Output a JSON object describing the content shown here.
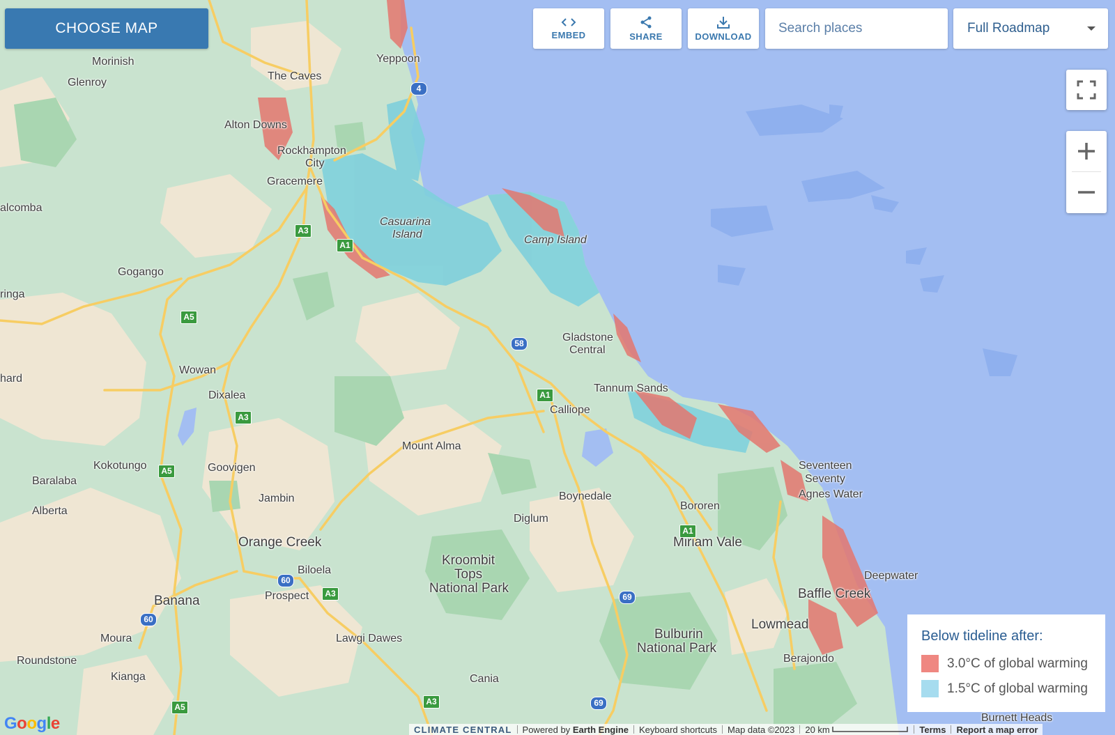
{
  "toolbar": {
    "choose_map_label": "CHOOSE MAP",
    "embed_label": "EMBED",
    "share_label": "SHARE",
    "download_label": "DOWNLOAD",
    "search_placeholder": "Search places",
    "map_type_selected": "Full Roadmap"
  },
  "legend": {
    "title": "Below tideline after:",
    "items": [
      {
        "label": "3.0°C of global warming",
        "color": "#ef8781"
      },
      {
        "label": "1.5°C of global warming",
        "color": "#a6dcef"
      }
    ]
  },
  "map": {
    "colors": {
      "water": "#a3bef2",
      "land": "#c9e3cf",
      "flood_high": "#e4776f",
      "flood_low": "#7fd0dc",
      "road": "#f7cd63"
    },
    "places": [
      {
        "name": "Morinish"
      },
      {
        "name": "Glenroy"
      },
      {
        "name": "The Caves"
      },
      {
        "name": "Yeppoon"
      },
      {
        "name": "Alton Downs"
      },
      {
        "name": "Rockhampton"
      },
      {
        "name": "City"
      },
      {
        "name": "Gracemere"
      },
      {
        "name": "alcomba"
      },
      {
        "name": "Casuarina"
      },
      {
        "name": "Island"
      },
      {
        "name": "Camp Island"
      },
      {
        "name": "Gogango"
      },
      {
        "name": "ringa"
      },
      {
        "name": "Gladstone"
      },
      {
        "name": "Central"
      },
      {
        "name": "Wowan"
      },
      {
        "name": "hard"
      },
      {
        "name": "Tannum Sands"
      },
      {
        "name": "Dixalea"
      },
      {
        "name": "Calliope"
      },
      {
        "name": "Mount Alma"
      },
      {
        "name": "Kokotungo"
      },
      {
        "name": "Goovigen"
      },
      {
        "name": "Seventeen"
      },
      {
        "name": "Seventy"
      },
      {
        "name": "Baralaba"
      },
      {
        "name": "Agnes Water"
      },
      {
        "name": "Boynedale"
      },
      {
        "name": "Jambin"
      },
      {
        "name": "Bororen"
      },
      {
        "name": "Alberta"
      },
      {
        "name": "Diglum"
      },
      {
        "name": "Miriam Vale"
      },
      {
        "name": "Orange Creek"
      },
      {
        "name": "Kroombit"
      },
      {
        "name": "Tops"
      },
      {
        "name": "National Park"
      },
      {
        "name": "Biloela"
      },
      {
        "name": "Deepwater"
      },
      {
        "name": "Prospect"
      },
      {
        "name": "Baffle Creek"
      },
      {
        "name": "Banana"
      },
      {
        "name": "Lowmead"
      },
      {
        "name": "Bulburin"
      },
      {
        "name": "National Park"
      },
      {
        "name": "Moura"
      },
      {
        "name": "Lawgi Dawes"
      },
      {
        "name": "Roundstone"
      },
      {
        "name": "Berajondo"
      },
      {
        "name": "Kianga"
      },
      {
        "name": "Cania"
      },
      {
        "name": "Burnett Heads"
      }
    ],
    "shields": [
      "4",
      "A3",
      "A1",
      "A5",
      "58",
      "A1",
      "A3",
      "A5",
      "60",
      "A3",
      "60",
      "69",
      "A1",
      "A5",
      "A3",
      "69"
    ]
  },
  "footer": {
    "google": "Google",
    "climate_central": "CLIMATE CENTRAL",
    "powered_by": "Powered by",
    "earth_engine": "Earth Engine",
    "keyboard_shortcuts": "Keyboard shortcuts",
    "map_data": "Map data ©2023",
    "scale": "20 km",
    "terms": "Terms",
    "report": "Report a map error"
  }
}
